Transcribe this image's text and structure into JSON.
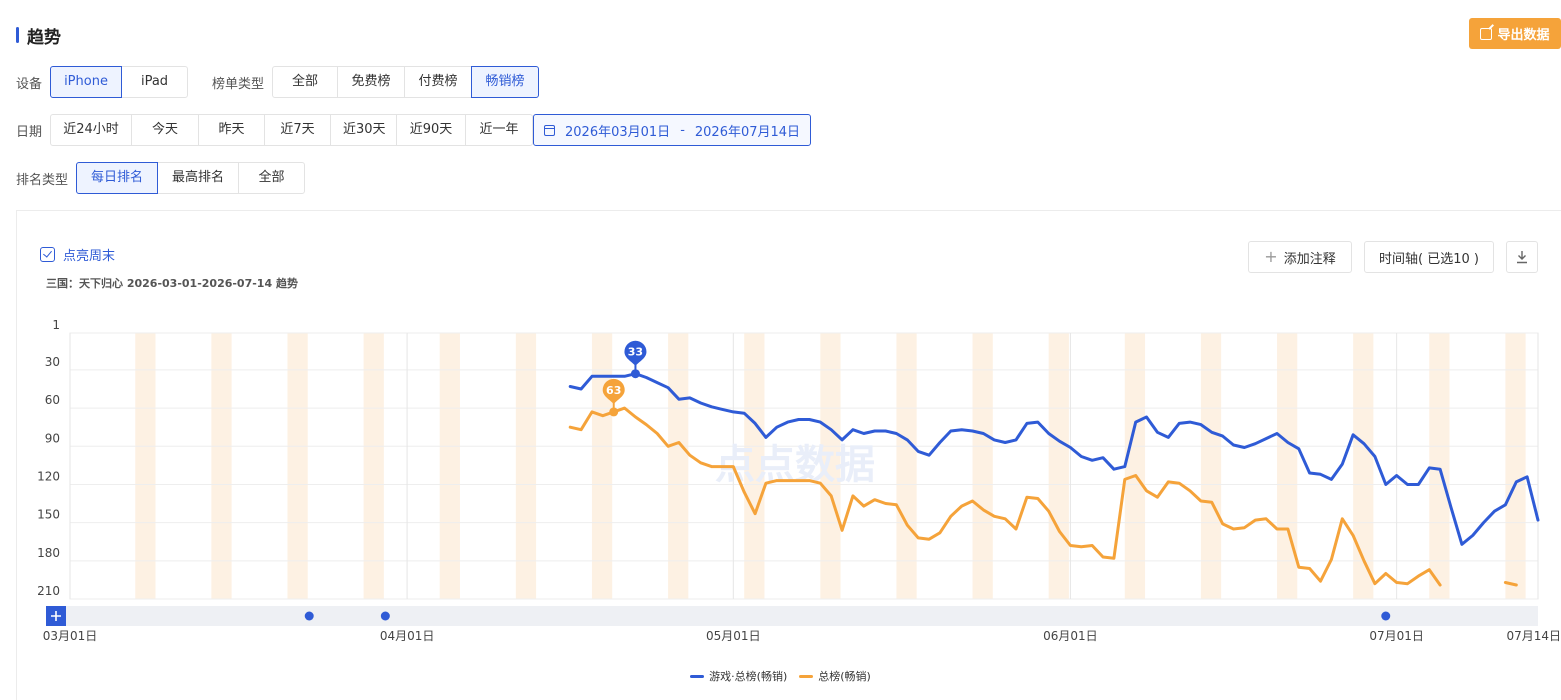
{
  "header": {
    "title": "趋势",
    "export_label": "导出数据"
  },
  "filters": {
    "device": {
      "label": "设备",
      "options": [
        "iPhone",
        "iPad"
      ],
      "selected": "iPhone"
    },
    "chart_type": {
      "label": "榜单类型",
      "options": [
        "全部",
        "免费榜",
        "付费榜",
        "畅销榜"
      ],
      "selected": "畅销榜"
    },
    "date": {
      "label": "日期",
      "options": [
        "近24小时",
        "今天",
        "昨天",
        "近7天",
        "近30天",
        "近90天",
        "近一年"
      ],
      "range_start": "2026年03月01日",
      "range_sep": "-",
      "range_end": "2026年07月14日"
    },
    "rank_type": {
      "label": "排名类型",
      "options": [
        "每日排名",
        "最高排名",
        "全部"
      ],
      "selected": "每日排名"
    }
  },
  "toolbar": {
    "weekend_label": "点亮周末",
    "add_note_label": "添加注释",
    "timeline_label": "时间轴( 已选10 )"
  },
  "chart_subtitle": "三国：天下归心 2026-03-01-2026-07-14 趋势",
  "watermark": "点点数据",
  "colors": {
    "blue": "#2f5bd6",
    "orange": "#f5a33a",
    "weekend": "#fdf1e3",
    "accent": "#2f5bd6"
  },
  "icons": {
    "export": "external-link-icon",
    "calendar": "calendar-icon",
    "add": "plus-icon",
    "download": "download-icon"
  },
  "chart_data": {
    "type": "line",
    "y_inverted": true,
    "ylim": [
      1,
      210
    ],
    "y_ticks": [
      1,
      30,
      60,
      90,
      120,
      150,
      180,
      210
    ],
    "x_tick_labels": [
      "03月01日",
      "04月01日",
      "05月01日",
      "06月01日",
      "07月01日",
      "07月14日"
    ],
    "x_start": "2026-03-01",
    "x_end": "2026-07-14",
    "markers": [
      {
        "series": 0,
        "date": "2026-04-22",
        "value": 33
      },
      {
        "series": 1,
        "date": "2026-04-20",
        "value": 63
      }
    ],
    "timeline_dots": [
      "2026-03-23",
      "2026-03-30",
      "2026-06-30"
    ],
    "series": [
      {
        "name": "游戏·总榜(畅销)",
        "color": "#2f5bd6",
        "points": [
          [
            "2026-04-16",
            43
          ],
          [
            "2026-04-17",
            45
          ],
          [
            "2026-04-18",
            35
          ],
          [
            "2026-04-19",
            35
          ],
          [
            "2026-04-20",
            35
          ],
          [
            "2026-04-21",
            35
          ],
          [
            "2026-04-22",
            33
          ],
          [
            "2026-04-23",
            36
          ],
          [
            "2026-04-24",
            40
          ],
          [
            "2026-04-25",
            44
          ],
          [
            "2026-04-26",
            53
          ],
          [
            "2026-04-27",
            52
          ],
          [
            "2026-04-28",
            56
          ],
          [
            "2026-04-29",
            59
          ],
          [
            "2026-04-30",
            61
          ],
          [
            "2026-05-01",
            63
          ],
          [
            "2026-05-02",
            64
          ],
          [
            "2026-05-03",
            72
          ],
          [
            "2026-05-04",
            83
          ],
          [
            "2026-05-05",
            75
          ],
          [
            "2026-05-06",
            71
          ],
          [
            "2026-05-07",
            69
          ],
          [
            "2026-05-08",
            69
          ],
          [
            "2026-05-09",
            71
          ],
          [
            "2026-05-10",
            77
          ],
          [
            "2026-05-11",
            85
          ],
          [
            "2026-05-12",
            77
          ],
          [
            "2026-05-13",
            80
          ],
          [
            "2026-05-14",
            78
          ],
          [
            "2026-05-15",
            78
          ],
          [
            "2026-05-16",
            80
          ],
          [
            "2026-05-17",
            85
          ],
          [
            "2026-05-18",
            94
          ],
          [
            "2026-05-19",
            97
          ],
          [
            "2026-05-20",
            87
          ],
          [
            "2026-05-21",
            78
          ],
          [
            "2026-05-22",
            77
          ],
          [
            "2026-05-23",
            78
          ],
          [
            "2026-05-24",
            80
          ],
          [
            "2026-05-25",
            85
          ],
          [
            "2026-05-26",
            87
          ],
          [
            "2026-05-27",
            85
          ],
          [
            "2026-05-28",
            72
          ],
          [
            "2026-05-29",
            71
          ],
          [
            "2026-05-30",
            80
          ],
          [
            "2026-05-31",
            86
          ],
          [
            "2026-06-01",
            91
          ],
          [
            "2026-06-02",
            98
          ],
          [
            "2026-06-03",
            101
          ],
          [
            "2026-06-04",
            99
          ],
          [
            "2026-06-05",
            108
          ],
          [
            "2026-06-06",
            106
          ],
          [
            "2026-06-07",
            71
          ],
          [
            "2026-06-08",
            67
          ],
          [
            "2026-06-09",
            79
          ],
          [
            "2026-06-10",
            83
          ],
          [
            "2026-06-11",
            72
          ],
          [
            "2026-06-12",
            71
          ],
          [
            "2026-06-13",
            73
          ],
          [
            "2026-06-14",
            79
          ],
          [
            "2026-06-15",
            82
          ],
          [
            "2026-06-16",
            89
          ],
          [
            "2026-06-17",
            91
          ],
          [
            "2026-06-18",
            88
          ],
          [
            "2026-06-19",
            84
          ],
          [
            "2026-06-20",
            80
          ],
          [
            "2026-06-21",
            87
          ],
          [
            "2026-06-22",
            92
          ],
          [
            "2026-06-23",
            111
          ],
          [
            "2026-06-24",
            112
          ],
          [
            "2026-06-25",
            116
          ],
          [
            "2026-06-26",
            104
          ],
          [
            "2026-06-27",
            81
          ],
          [
            "2026-06-28",
            88
          ],
          [
            "2026-06-29",
            98
          ],
          [
            "2026-06-30",
            120
          ],
          [
            "2026-07-01",
            113
          ],
          [
            "2026-07-02",
            120
          ],
          [
            "2026-07-03",
            120
          ],
          [
            "2026-07-04",
            107
          ],
          [
            "2026-07-05",
            108
          ],
          [
            "2026-07-06",
            138
          ],
          [
            "2026-07-07",
            167
          ],
          [
            "2026-07-08",
            160
          ],
          [
            "2026-07-09",
            150
          ],
          [
            "2026-07-10",
            141
          ],
          [
            "2026-07-11",
            136
          ],
          [
            "2026-07-12",
            118
          ],
          [
            "2026-07-13",
            114
          ],
          [
            "2026-07-14",
            148
          ]
        ]
      },
      {
        "name": "总榜(畅销)",
        "color": "#f5a33a",
        "points": [
          [
            "2026-04-16",
            75
          ],
          [
            "2026-04-17",
            77
          ],
          [
            "2026-04-18",
            63
          ],
          [
            "2026-04-19",
            66
          ],
          [
            "2026-04-20",
            63
          ],
          [
            "2026-04-21",
            60
          ],
          [
            "2026-04-22",
            67
          ],
          [
            "2026-04-23",
            73
          ],
          [
            "2026-04-24",
            80
          ],
          [
            "2026-04-25",
            90
          ],
          [
            "2026-04-26",
            87
          ],
          [
            "2026-04-27",
            97
          ],
          [
            "2026-04-28",
            103
          ],
          [
            "2026-04-29",
            106
          ],
          [
            "2026-04-30",
            106
          ],
          [
            "2026-05-01",
            106
          ],
          [
            "2026-05-02",
            126
          ],
          [
            "2026-05-03",
            143
          ],
          [
            "2026-05-04",
            119
          ],
          [
            "2026-05-05",
            117
          ],
          [
            "2026-05-06",
            117
          ],
          [
            "2026-05-07",
            117
          ],
          [
            "2026-05-08",
            117
          ],
          [
            "2026-05-09",
            119
          ],
          [
            "2026-05-10",
            129
          ],
          [
            "2026-05-11",
            156
          ],
          [
            "2026-05-12",
            129
          ],
          [
            "2026-05-13",
            137
          ],
          [
            "2026-05-14",
            132
          ],
          [
            "2026-05-15",
            135
          ],
          [
            "2026-05-16",
            136
          ],
          [
            "2026-05-17",
            152
          ],
          [
            "2026-05-18",
            162
          ],
          [
            "2026-05-19",
            163
          ],
          [
            "2026-05-20",
            158
          ],
          [
            "2026-05-21",
            145
          ],
          [
            "2026-05-22",
            137
          ],
          [
            "2026-05-23",
            133
          ],
          [
            "2026-05-24",
            140
          ],
          [
            "2026-05-25",
            145
          ],
          [
            "2026-05-26",
            147
          ],
          [
            "2026-05-27",
            155
          ],
          [
            "2026-05-28",
            130
          ],
          [
            "2026-05-29",
            131
          ],
          [
            "2026-05-30",
            141
          ],
          [
            "2026-05-31",
            157
          ],
          [
            "2026-06-01",
            168
          ],
          [
            "2026-06-02",
            169
          ],
          [
            "2026-06-03",
            168
          ],
          [
            "2026-06-04",
            177
          ],
          [
            "2026-06-05",
            178
          ],
          [
            "2026-06-06",
            116
          ],
          [
            "2026-06-07",
            113
          ],
          [
            "2026-06-08",
            125
          ],
          [
            "2026-06-09",
            130
          ],
          [
            "2026-06-10",
            118
          ],
          [
            "2026-06-11",
            119
          ],
          [
            "2026-06-12",
            125
          ],
          [
            "2026-06-13",
            133
          ],
          [
            "2026-06-14",
            134
          ],
          [
            "2026-06-15",
            151
          ],
          [
            "2026-06-16",
            155
          ],
          [
            "2026-06-17",
            154
          ],
          [
            "2026-06-18",
            148
          ],
          [
            "2026-06-19",
            147
          ],
          [
            "2026-06-20",
            155
          ],
          [
            "2026-06-21",
            155
          ],
          [
            "2026-06-22",
            185
          ],
          [
            "2026-06-23",
            186
          ],
          [
            "2026-06-24",
            196
          ],
          [
            "2026-06-25",
            179
          ],
          [
            "2026-06-26",
            147
          ],
          [
            "2026-06-27",
            160
          ],
          [
            "2026-06-28",
            180
          ],
          [
            "2026-06-29",
            198
          ],
          [
            "2026-06-30",
            190
          ],
          [
            "2026-07-01",
            197
          ],
          [
            "2026-07-02",
            198
          ],
          [
            "2026-07-03",
            192
          ],
          [
            "2026-07-04",
            187
          ],
          [
            "2026-07-05",
            199
          ],
          null,
          null,
          null,
          null,
          null,
          null,
          [
            "2026-07-11",
            197
          ],
          [
            "2026-07-12",
            199
          ]
        ]
      }
    ]
  }
}
